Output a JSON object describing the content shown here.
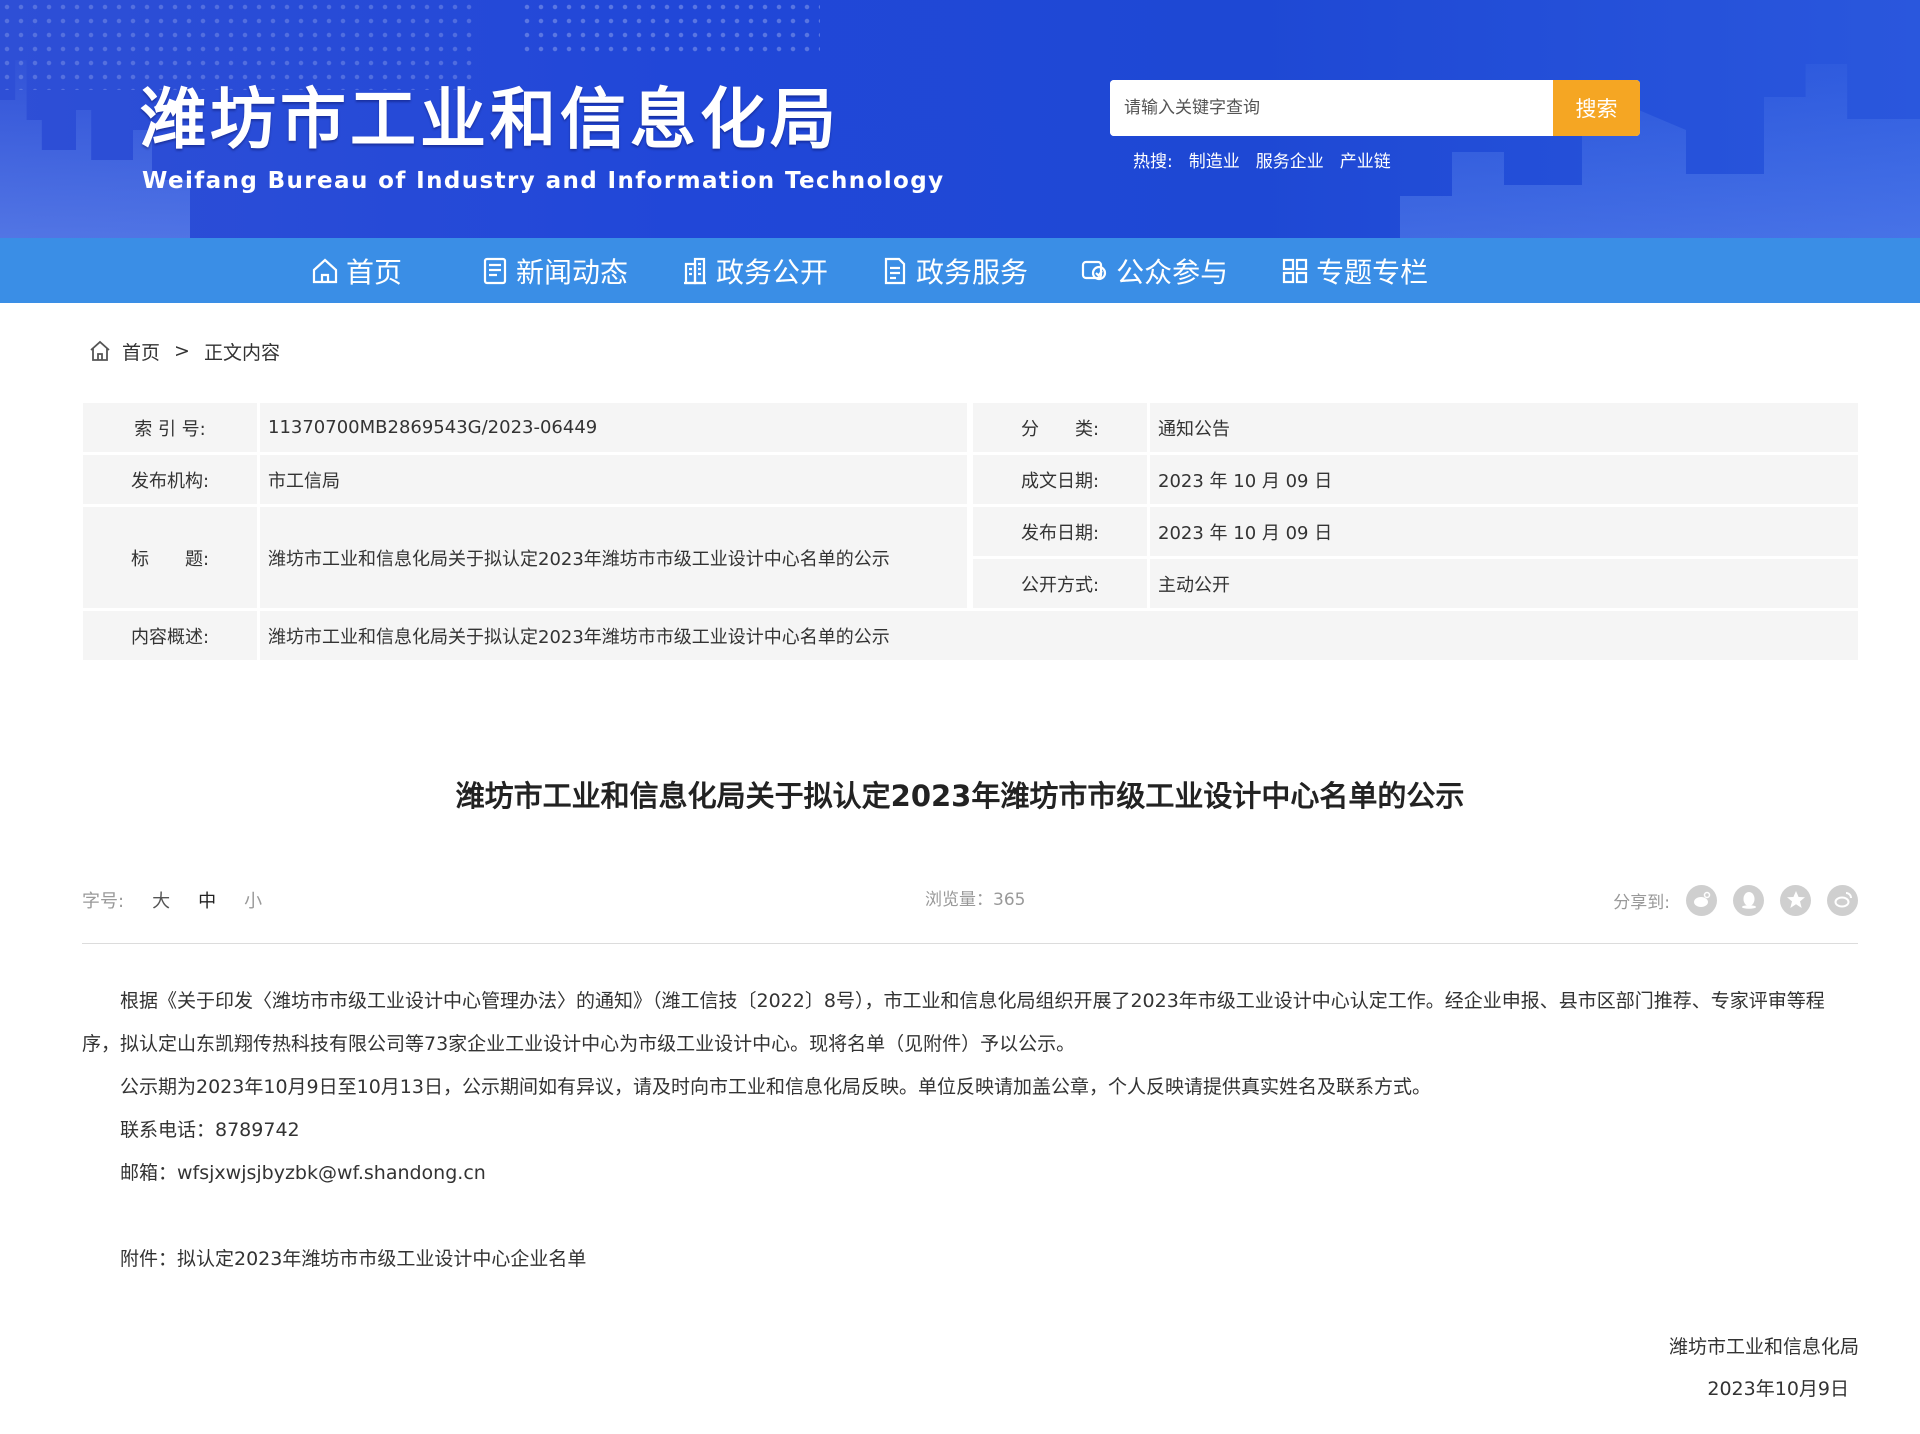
{
  "header": {
    "title": "潍坊市工业和信息化局",
    "subtitle": "Weifang Bureau of Industry and Information Technology",
    "search": {
      "placeholder": "请输入关键字查询",
      "button": "搜索"
    },
    "hot": {
      "label": "热搜:",
      "items": [
        "制造业",
        "服务企业",
        "产业链"
      ]
    }
  },
  "nav": {
    "items": [
      {
        "label": "首页",
        "icon": "home-icon"
      },
      {
        "label": "新闻动态",
        "icon": "news-icon"
      },
      {
        "label": "政务公开",
        "icon": "building-icon"
      },
      {
        "label": "政务服务",
        "icon": "document-icon"
      },
      {
        "label": "公众参与",
        "icon": "people-icon"
      },
      {
        "label": "专题专栏",
        "icon": "grid-icon"
      }
    ]
  },
  "breadcrumb": {
    "home": "首页",
    "separator": ">",
    "current": "正文内容"
  },
  "info": {
    "index_label": "索 引 号:",
    "index_value": "11370700MB2869543G/2023-06449",
    "category_label": "分　　类:",
    "category_value": "通知公告",
    "org_label": "发布机构:",
    "org_value": "市工信局",
    "written_label": "成文日期:",
    "written_value": "2023 年 10 月 09 日",
    "title_label": "标　　题:",
    "title_value": "潍坊市工业和信息化局关于拟认定2023年潍坊市市级工业设计中心名单的公示",
    "published_label": "发布日期:",
    "published_value": "2023 年 10 月 09 日",
    "disclosure_label": "公开方式:",
    "disclosure_value": "主动公开",
    "summary_label": "内容概述:",
    "summary_value": "潍坊市工业和信息化局关于拟认定2023年潍坊市市级工业设计中心名单的公示"
  },
  "article": {
    "title": "潍坊市工业和信息化局关于拟认定2023年潍坊市市级工业设计中心名单的公示",
    "font_size_label": "字号:",
    "font_sizes": [
      "大",
      "中",
      "小"
    ],
    "views": "浏览量：365",
    "share_label": "分享到:",
    "share_icons": [
      "weibo-icon",
      "qq-icon",
      "qzone-icon",
      "tencent-weibo-icon"
    ],
    "paragraphs": [
      "根据《关于印发〈潍坊市市级工业设计中心管理办法〉的通知》（潍工信技〔2022〕8号），市工业和信息化局组织开展了2023年市级工业设计中心认定工作。经企业申报、县市区部门推荐、专家评审等程序，拟认定山东凯翔传热科技有限公司等73家企业工业设计中心为市级工业设计中心。现将名单（见附件）予以公示。",
      "公示期为2023年10月9日至10月13日，公示期间如有异议，请及时向市工业和信息化局反映。单位反映请加盖公章，个人反映请提供真实姓名及联系方式。",
      "联系电话：8789742",
      "邮箱：wfsjxwjsjbyzbk@wf.shandong.cn"
    ],
    "attachment": "附件：拟认定2023年潍坊市市级工业设计中心企业名单",
    "signature": "潍坊市工业和信息化局",
    "date": "2023年10月9日"
  },
  "colors": {
    "banner": "#2147d8",
    "nav": "#3a8ee6",
    "search_button": "#f5a623",
    "table_bg": "#f5f5f5"
  }
}
